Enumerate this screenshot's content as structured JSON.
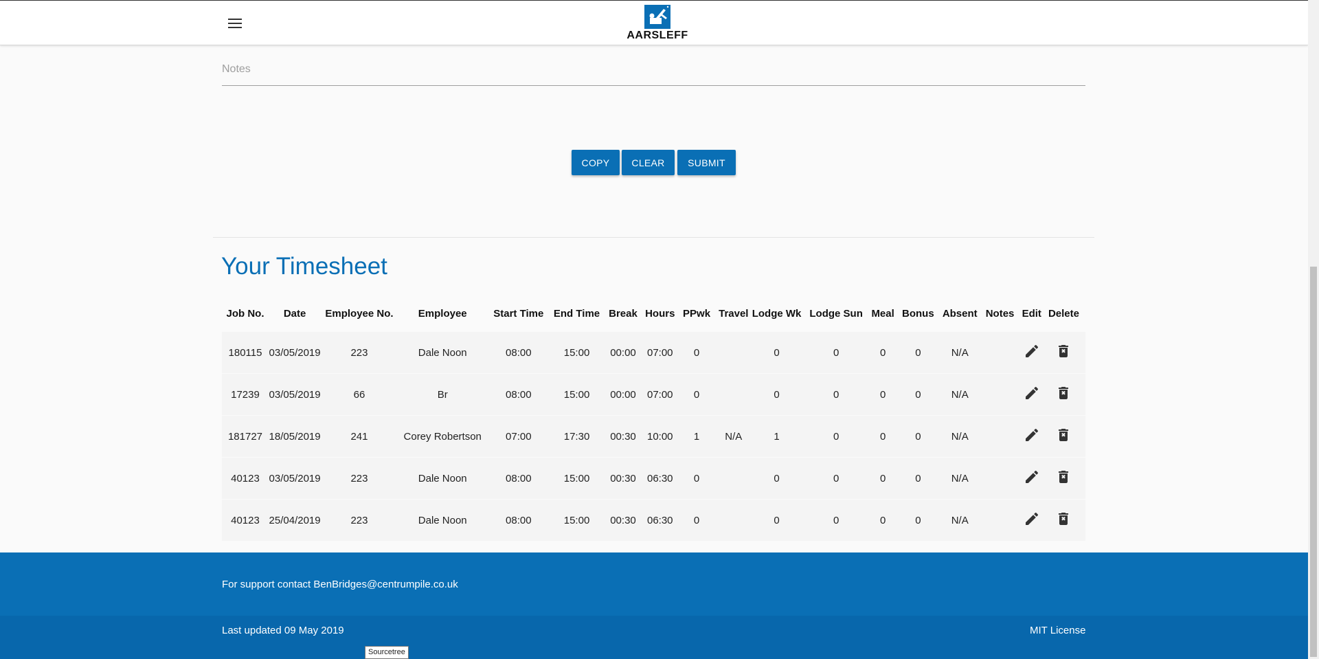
{
  "header": {
    "menu_icon": "hamburger-menu-icon",
    "logo_text": "AARSLEFF"
  },
  "form": {
    "notes_placeholder": "Notes",
    "notes_value": "",
    "buttons": {
      "copy": "COPY",
      "clear": "CLEAR",
      "submit": "SUBMIT"
    }
  },
  "timesheet": {
    "title": "Your Timesheet",
    "columns": [
      "Job No.",
      "Date",
      "Employee No.",
      "Employee",
      "Start Time",
      "End Time",
      "Break",
      "Hours",
      "PPwk",
      "Travel",
      "Lodge Wk",
      "Lodge Sun",
      "Meal",
      "Bonus",
      "Absent",
      "Notes",
      "Edit",
      "Delete"
    ],
    "rows": [
      [
        "180115",
        "03/05/2019",
        "223",
        "Dale Noon",
        "08:00",
        "15:00",
        "00:00",
        "07:00",
        "0",
        "",
        "0",
        "0",
        "0",
        "0",
        "N/A",
        ""
      ],
      [
        "17239",
        "03/05/2019",
        "66",
        "Br",
        "08:00",
        "15:00",
        "00:00",
        "07:00",
        "0",
        "",
        "0",
        "0",
        "0",
        "0",
        "N/A",
        ""
      ],
      [
        "181727",
        "18/05/2019",
        "241",
        "Corey Robertson",
        "07:00",
        "17:30",
        "00:30",
        "10:00",
        "1",
        "N/A",
        "1",
        "0",
        "0",
        "0",
        "N/A",
        ""
      ],
      [
        "40123",
        "03/05/2019",
        "223",
        "Dale Noon",
        "08:00",
        "15:00",
        "00:30",
        "06:30",
        "0",
        "",
        "0",
        "0",
        "0",
        "0",
        "N/A",
        ""
      ],
      [
        "40123",
        "25/04/2019",
        "223",
        "Dale Noon",
        "08:00",
        "15:00",
        "00:30",
        "06:30",
        "0",
        "",
        "0",
        "0",
        "0",
        "0",
        "N/A",
        ""
      ]
    ],
    "edit_icon": "pencil-icon",
    "delete_icon": "trash-icon"
  },
  "footer": {
    "support_text": "For support contact BenBridges@centrumpile.co.uk",
    "updated_text": "Last updated 09 May 2019",
    "license_text": "MIT License"
  },
  "tooltip": "Sourcetree",
  "colors": {
    "accent": "#0a6fb5",
    "footer_bottom": "#0867ac",
    "background": "#fafafa",
    "row_background": "#f4f4f4"
  }
}
